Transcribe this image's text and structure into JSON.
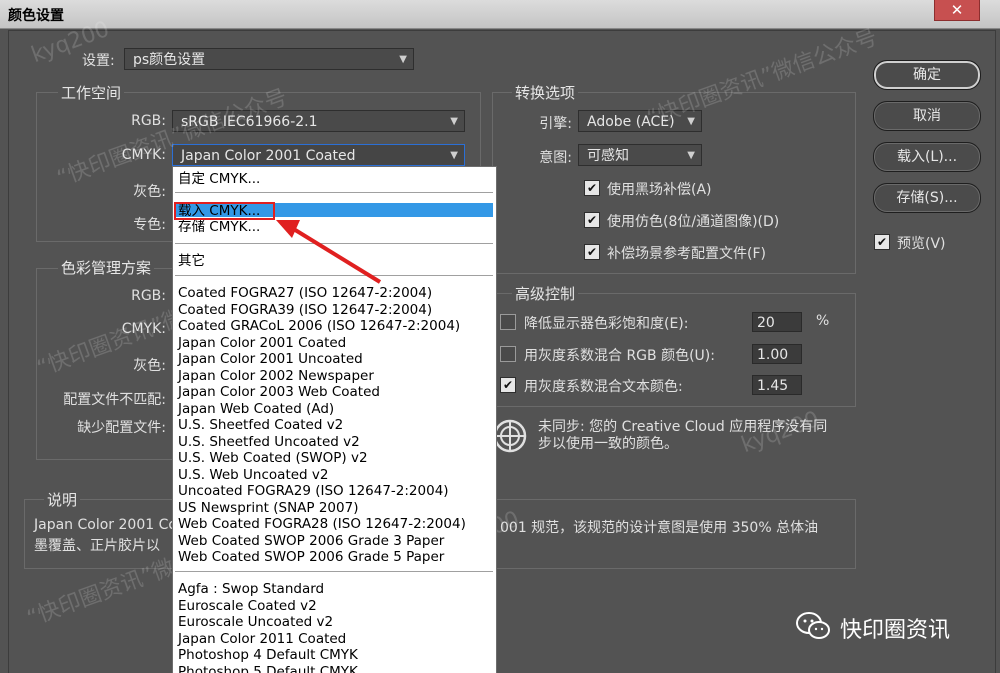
{
  "window": {
    "title": "颜色设置",
    "close": "✕"
  },
  "settings": {
    "label": "设置:",
    "value": "ps颜色设置"
  },
  "workspace": {
    "title": "工作空间",
    "rgb_label": "RGB:",
    "rgb_value": "sRGB IEC61966-2.1",
    "cmyk_label": "CMYK:",
    "cmyk_value": "Japan Color 2001 Coated",
    "gray_label": "灰色:",
    "spot_label": "专色:"
  },
  "color_mgmt": {
    "title": "色彩管理方案",
    "rgb_label": "RGB:",
    "cmyk_label": "CMYK:",
    "gray_label": "灰色:",
    "mismatch_label": "配置文件不匹配:",
    "missing_label": "缺少配置文件:"
  },
  "conversion": {
    "title": "转换选项",
    "engine_label": "引擎:",
    "engine_value": "Adobe (ACE)",
    "intent_label": "意图:",
    "intent_value": "可感知",
    "bpc": "使用黑场补偿(A)",
    "dither": "使用仿色(8位/通道图像)(D)",
    "compensate": "补偿场景参考配置文件(F)"
  },
  "advanced": {
    "title": "高级控制",
    "desaturate": "降低显示器色彩饱和度(E):",
    "desaturate_value": "20",
    "desaturate_unit": "%",
    "blend_rgb": "用灰度系数混合 RGB 颜色(U):",
    "blend_rgb_value": "1.00",
    "blend_text": "用灰度系数混合文本颜色:",
    "blend_text_value": "1.45"
  },
  "sync": {
    "line1": "未同步: 您的 Creative Cloud 应用程序没有同",
    "line2": "步以使用一致的颜色。"
  },
  "description": {
    "title": "说明",
    "line1_left": "Japan Color 2001 Coa",
    "line1_right": "001 规范，该规范的设计意图是使用 350% 总体油",
    "line2_left": "墨覆盖、正片胶片以"
  },
  "buttons": {
    "ok": "确定",
    "cancel": "取消",
    "load": "载入(L)...",
    "save": "存储(S)...",
    "preview": "预览(V)"
  },
  "dropdown": {
    "custom": "自定 CMYK...",
    "load": "载入 CMYK...",
    "save": "存储 CMYK...",
    "other": "其它",
    "group1": [
      "Coated FOGRA27 (ISO 12647-2:2004)",
      "Coated FOGRA39 (ISO 12647-2:2004)",
      "Coated GRACoL 2006 (ISO 12647-2:2004)",
      "Japan Color 2001 Coated",
      "Japan Color 2001 Uncoated",
      "Japan Color 2002 Newspaper",
      "Japan Color 2003 Web Coated",
      "Japan Web Coated (Ad)",
      "U.S. Sheetfed Coated v2",
      "U.S. Sheetfed Uncoated v2",
      "U.S. Web Coated (SWOP) v2",
      "U.S. Web Uncoated v2",
      "Uncoated FOGRA29 (ISO 12647-2:2004)",
      "US Newsprint (SNAP 2007)",
      "Web Coated FOGRA28 (ISO 12647-2:2004)",
      "Web Coated SWOP 2006 Grade 3 Paper",
      "Web Coated SWOP 2006 Grade 5 Paper"
    ],
    "group2": [
      "Agfa : Swop Standard",
      "Euroscale Coated v2",
      "Euroscale Uncoated v2",
      "Japan Color 2011 Coated",
      "Photoshop 4 Default CMYK",
      "Photoshop 5 Default CMYK"
    ]
  },
  "watermarks": [
    "kyq200",
    "“快印圈资讯”微信公众号",
    "kyq200",
    "“快印圈资讯”微信公众号",
    "kyq200",
    "“快印圈资讯”微信公众号",
    "kyq200",
    "“快印圈资讯”微信公众号"
  ],
  "brand": {
    "name": "快印圈资讯",
    "icon": "wechat-icon"
  },
  "colors": {
    "highlight": "#3398e6",
    "annotation": "#e02020",
    "panel": "#535353"
  }
}
